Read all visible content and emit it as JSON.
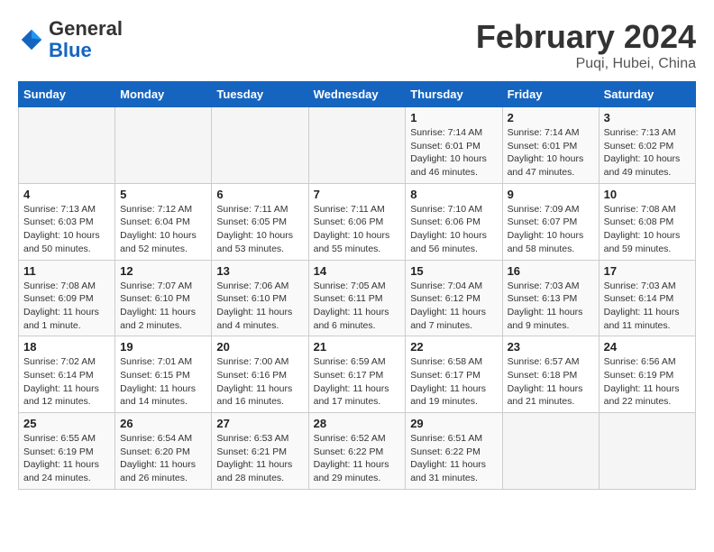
{
  "logo": {
    "text_general": "General",
    "text_blue": "Blue"
  },
  "title": "February 2024",
  "subtitle": "Puqi, Hubei, China",
  "headers": [
    "Sunday",
    "Monday",
    "Tuesday",
    "Wednesday",
    "Thursday",
    "Friday",
    "Saturday"
  ],
  "weeks": [
    [
      {
        "day": "",
        "detail": ""
      },
      {
        "day": "",
        "detail": ""
      },
      {
        "day": "",
        "detail": ""
      },
      {
        "day": "",
        "detail": ""
      },
      {
        "day": "1",
        "detail": "Sunrise: 7:14 AM\nSunset: 6:01 PM\nDaylight: 10 hours and 46 minutes."
      },
      {
        "day": "2",
        "detail": "Sunrise: 7:14 AM\nSunset: 6:01 PM\nDaylight: 10 hours and 47 minutes."
      },
      {
        "day": "3",
        "detail": "Sunrise: 7:13 AM\nSunset: 6:02 PM\nDaylight: 10 hours and 49 minutes."
      }
    ],
    [
      {
        "day": "4",
        "detail": "Sunrise: 7:13 AM\nSunset: 6:03 PM\nDaylight: 10 hours and 50 minutes."
      },
      {
        "day": "5",
        "detail": "Sunrise: 7:12 AM\nSunset: 6:04 PM\nDaylight: 10 hours and 52 minutes."
      },
      {
        "day": "6",
        "detail": "Sunrise: 7:11 AM\nSunset: 6:05 PM\nDaylight: 10 hours and 53 minutes."
      },
      {
        "day": "7",
        "detail": "Sunrise: 7:11 AM\nSunset: 6:06 PM\nDaylight: 10 hours and 55 minutes."
      },
      {
        "day": "8",
        "detail": "Sunrise: 7:10 AM\nSunset: 6:06 PM\nDaylight: 10 hours and 56 minutes."
      },
      {
        "day": "9",
        "detail": "Sunrise: 7:09 AM\nSunset: 6:07 PM\nDaylight: 10 hours and 58 minutes."
      },
      {
        "day": "10",
        "detail": "Sunrise: 7:08 AM\nSunset: 6:08 PM\nDaylight: 10 hours and 59 minutes."
      }
    ],
    [
      {
        "day": "11",
        "detail": "Sunrise: 7:08 AM\nSunset: 6:09 PM\nDaylight: 11 hours and 1 minute."
      },
      {
        "day": "12",
        "detail": "Sunrise: 7:07 AM\nSunset: 6:10 PM\nDaylight: 11 hours and 2 minutes."
      },
      {
        "day": "13",
        "detail": "Sunrise: 7:06 AM\nSunset: 6:10 PM\nDaylight: 11 hours and 4 minutes."
      },
      {
        "day": "14",
        "detail": "Sunrise: 7:05 AM\nSunset: 6:11 PM\nDaylight: 11 hours and 6 minutes."
      },
      {
        "day": "15",
        "detail": "Sunrise: 7:04 AM\nSunset: 6:12 PM\nDaylight: 11 hours and 7 minutes."
      },
      {
        "day": "16",
        "detail": "Sunrise: 7:03 AM\nSunset: 6:13 PM\nDaylight: 11 hours and 9 minutes."
      },
      {
        "day": "17",
        "detail": "Sunrise: 7:03 AM\nSunset: 6:14 PM\nDaylight: 11 hours and 11 minutes."
      }
    ],
    [
      {
        "day": "18",
        "detail": "Sunrise: 7:02 AM\nSunset: 6:14 PM\nDaylight: 11 hours and 12 minutes."
      },
      {
        "day": "19",
        "detail": "Sunrise: 7:01 AM\nSunset: 6:15 PM\nDaylight: 11 hours and 14 minutes."
      },
      {
        "day": "20",
        "detail": "Sunrise: 7:00 AM\nSunset: 6:16 PM\nDaylight: 11 hours and 16 minutes."
      },
      {
        "day": "21",
        "detail": "Sunrise: 6:59 AM\nSunset: 6:17 PM\nDaylight: 11 hours and 17 minutes."
      },
      {
        "day": "22",
        "detail": "Sunrise: 6:58 AM\nSunset: 6:17 PM\nDaylight: 11 hours and 19 minutes."
      },
      {
        "day": "23",
        "detail": "Sunrise: 6:57 AM\nSunset: 6:18 PM\nDaylight: 11 hours and 21 minutes."
      },
      {
        "day": "24",
        "detail": "Sunrise: 6:56 AM\nSunset: 6:19 PM\nDaylight: 11 hours and 22 minutes."
      }
    ],
    [
      {
        "day": "25",
        "detail": "Sunrise: 6:55 AM\nSunset: 6:19 PM\nDaylight: 11 hours and 24 minutes."
      },
      {
        "day": "26",
        "detail": "Sunrise: 6:54 AM\nSunset: 6:20 PM\nDaylight: 11 hours and 26 minutes."
      },
      {
        "day": "27",
        "detail": "Sunrise: 6:53 AM\nSunset: 6:21 PM\nDaylight: 11 hours and 28 minutes."
      },
      {
        "day": "28",
        "detail": "Sunrise: 6:52 AM\nSunset: 6:22 PM\nDaylight: 11 hours and 29 minutes."
      },
      {
        "day": "29",
        "detail": "Sunrise: 6:51 AM\nSunset: 6:22 PM\nDaylight: 11 hours and 31 minutes."
      },
      {
        "day": "",
        "detail": ""
      },
      {
        "day": "",
        "detail": ""
      }
    ]
  ]
}
